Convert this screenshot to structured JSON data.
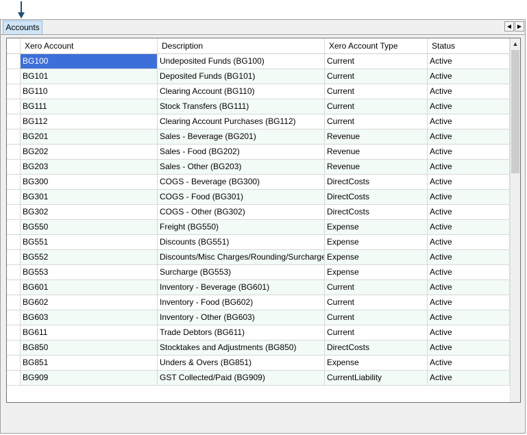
{
  "tabs": [
    {
      "label": "Accounts"
    }
  ],
  "columns": [
    "Xero Account",
    "Description",
    "Xero Account Type",
    "Status"
  ],
  "rows": [
    {
      "account": "BG100",
      "description": "Undeposited Funds (BG100)",
      "type": "Current",
      "status": "Active"
    },
    {
      "account": "BG101",
      "description": "Deposited Funds (BG101)",
      "type": "Current",
      "status": "Active"
    },
    {
      "account": "BG110",
      "description": "Clearing Account (BG110)",
      "type": "Current",
      "status": "Active"
    },
    {
      "account": "BG111",
      "description": "Stock Transfers (BG111)",
      "type": "Current",
      "status": "Active"
    },
    {
      "account": "BG112",
      "description": "Clearing Account Purchases (BG112)",
      "type": "Current",
      "status": "Active"
    },
    {
      "account": "BG201",
      "description": "Sales - Beverage (BG201)",
      "type": "Revenue",
      "status": "Active"
    },
    {
      "account": "BG202",
      "description": "Sales - Food (BG202)",
      "type": "Revenue",
      "status": "Active"
    },
    {
      "account": "BG203",
      "description": "Sales - Other (BG203)",
      "type": "Revenue",
      "status": "Active"
    },
    {
      "account": "BG300",
      "description": "COGS - Beverage (BG300)",
      "type": "DirectCosts",
      "status": "Active"
    },
    {
      "account": "BG301",
      "description": "COGS - Food (BG301)",
      "type": "DirectCosts",
      "status": "Active"
    },
    {
      "account": "BG302",
      "description": "COGS - Other (BG302)",
      "type": "DirectCosts",
      "status": "Active"
    },
    {
      "account": "BG550",
      "description": "Freight (BG550)",
      "type": "Expense",
      "status": "Active"
    },
    {
      "account": "BG551",
      "description": "Discounts (BG551)",
      "type": "Expense",
      "status": "Active"
    },
    {
      "account": "BG552",
      "description": "Discounts/Misc Charges/Rounding/Surcharges...",
      "type": "Expense",
      "status": "Active"
    },
    {
      "account": "BG553",
      "description": "Surcharge (BG553)",
      "type": "Expense",
      "status": "Active"
    },
    {
      "account": "BG601",
      "description": "Inventory - Beverage (BG601)",
      "type": "Current",
      "status": "Active"
    },
    {
      "account": "BG602",
      "description": "Inventory - Food (BG602)",
      "type": "Current",
      "status": "Active"
    },
    {
      "account": "BG603",
      "description": "Inventory - Other (BG603)",
      "type": "Current",
      "status": "Active"
    },
    {
      "account": "BG611",
      "description": "Trade Debtors (BG611)",
      "type": "Current",
      "status": "Active"
    },
    {
      "account": "BG850",
      "description": "Stocktakes and Adjustments (BG850)",
      "type": "DirectCosts",
      "status": "Active"
    },
    {
      "account": "BG851",
      "description": "Unders & Overs (BG851)",
      "type": "Expense",
      "status": "Active"
    },
    {
      "account": "BG909",
      "description": "GST Collected/Paid (BG909)",
      "type": "CurrentLiability",
      "status": "Active"
    }
  ],
  "selected_cell": {
    "row": 0,
    "column": "account"
  },
  "colors": {
    "selection": "#3d6fd8",
    "tab": "#cfe5f7",
    "alt_row": "#f2fbf6",
    "arrow": "#1f4e79"
  }
}
